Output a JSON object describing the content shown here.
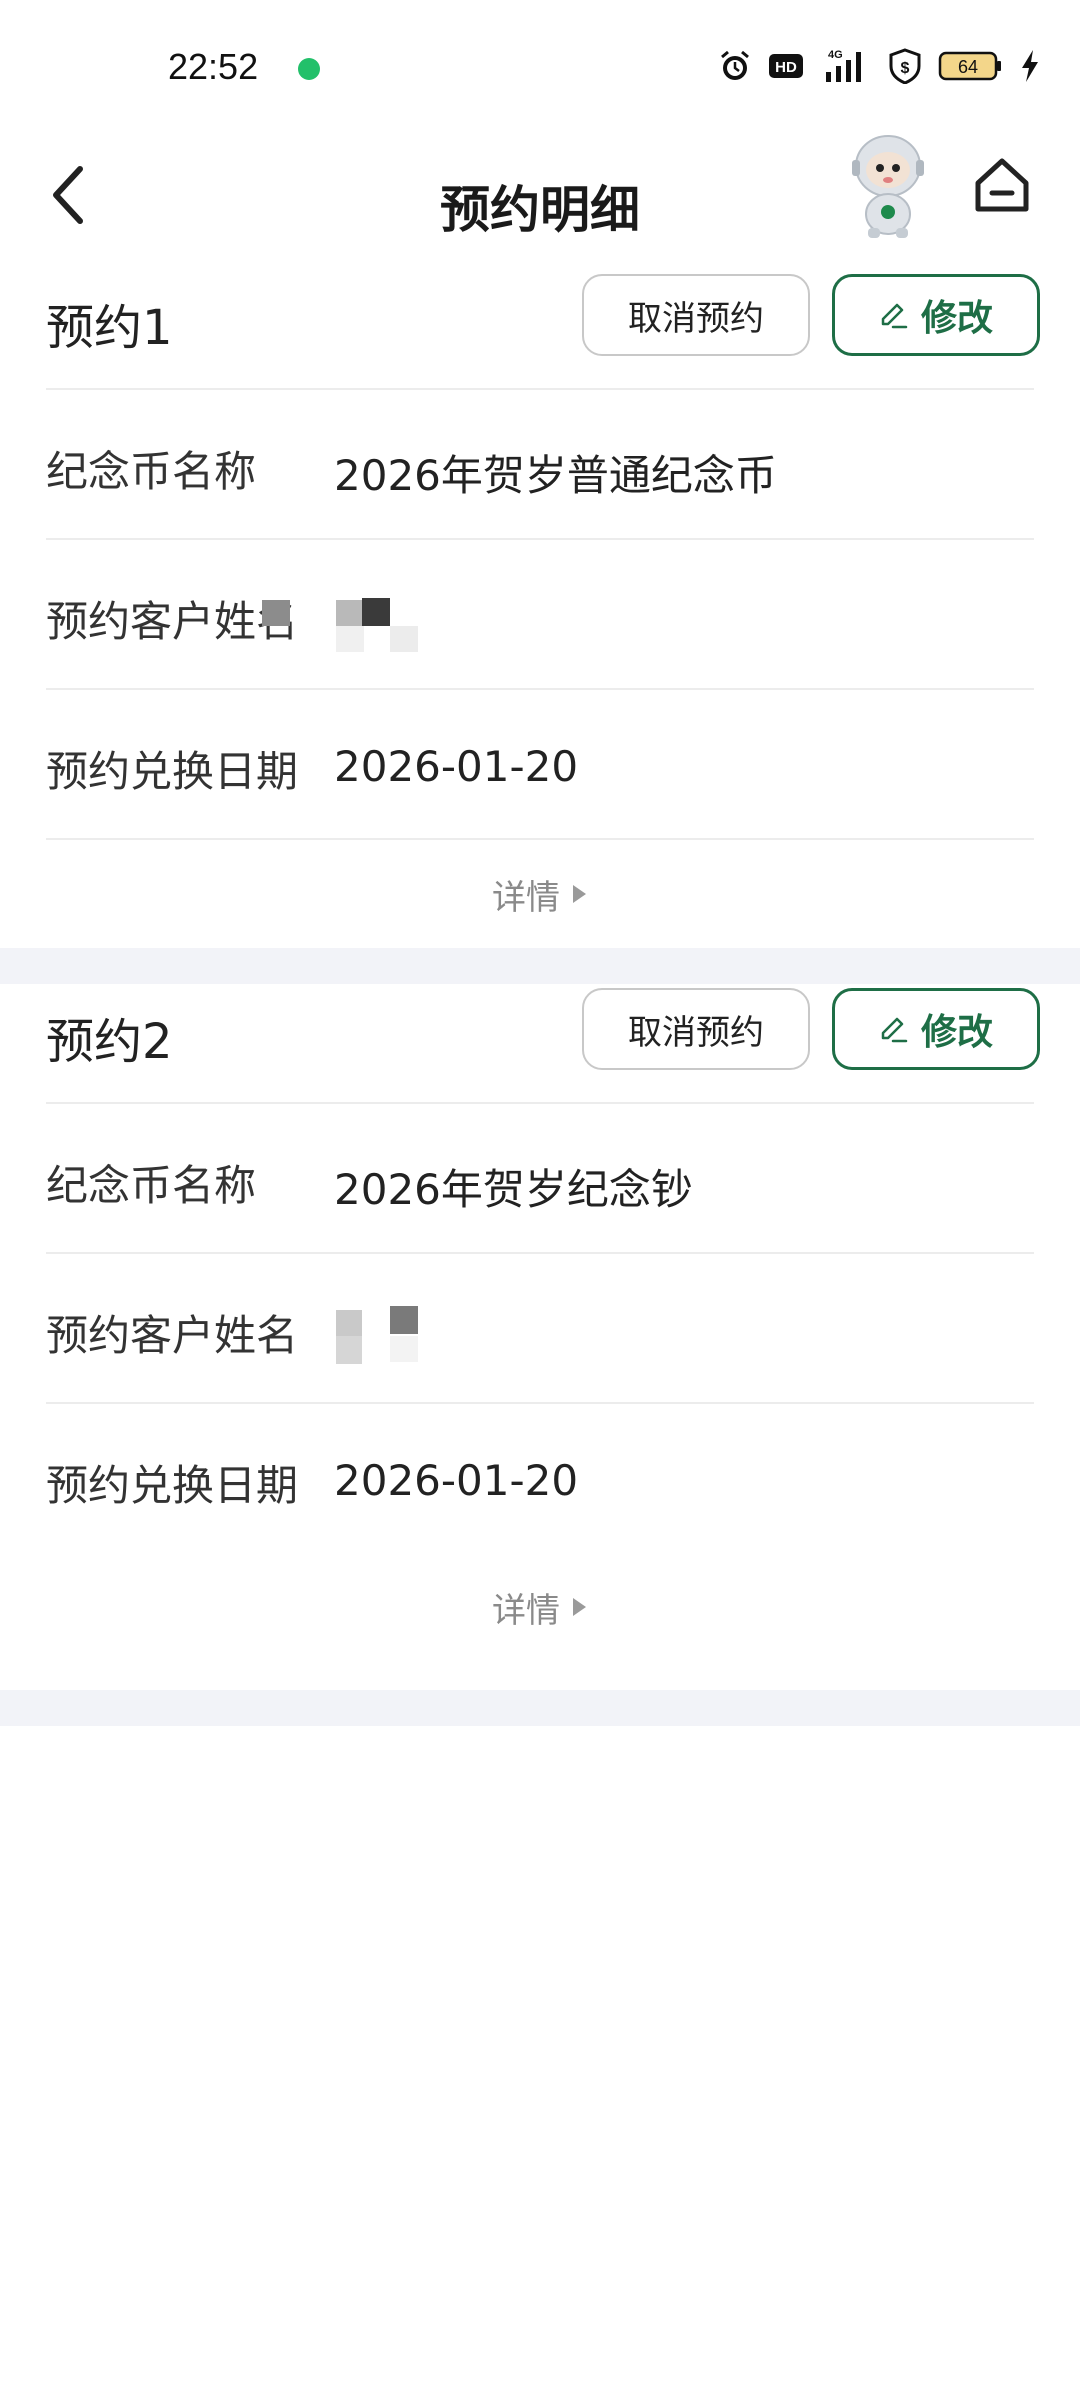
{
  "status_bar": {
    "time": "22:52",
    "battery": "64",
    "network": "4G"
  },
  "header": {
    "title": "预约明细"
  },
  "reservations": [
    {
      "title": "预约1",
      "cancel_label": "取消预约",
      "edit_label": "修改",
      "rows": [
        {
          "label": "纪念币名称",
          "value": "2026年贺岁普通纪念币"
        },
        {
          "label": "预约客户姓名",
          "value": ""
        },
        {
          "label": "预约兑换日期",
          "value": "2026-01-20"
        }
      ],
      "details_label": "详情"
    },
    {
      "title": "预约2",
      "cancel_label": "取消预约",
      "edit_label": "修改",
      "rows": [
        {
          "label": "纪念币名称",
          "value": "2026年贺岁纪念钞"
        },
        {
          "label": "预约客户姓名",
          "value": ""
        },
        {
          "label": "预约兑换日期",
          "value": "2026-01-20"
        }
      ],
      "details_label": "详情"
    }
  ],
  "colors": {
    "accent": "#1e6e46",
    "background_band": "#f2f3f8",
    "divider": "#ececec",
    "muted_text": "#8a8a8a"
  },
  "icons": {
    "back": "chevron-left-icon",
    "home": "home-icon",
    "avatar": "robot-assistant-icon",
    "edit": "pencil-icon",
    "details": "caret-right-icon"
  }
}
